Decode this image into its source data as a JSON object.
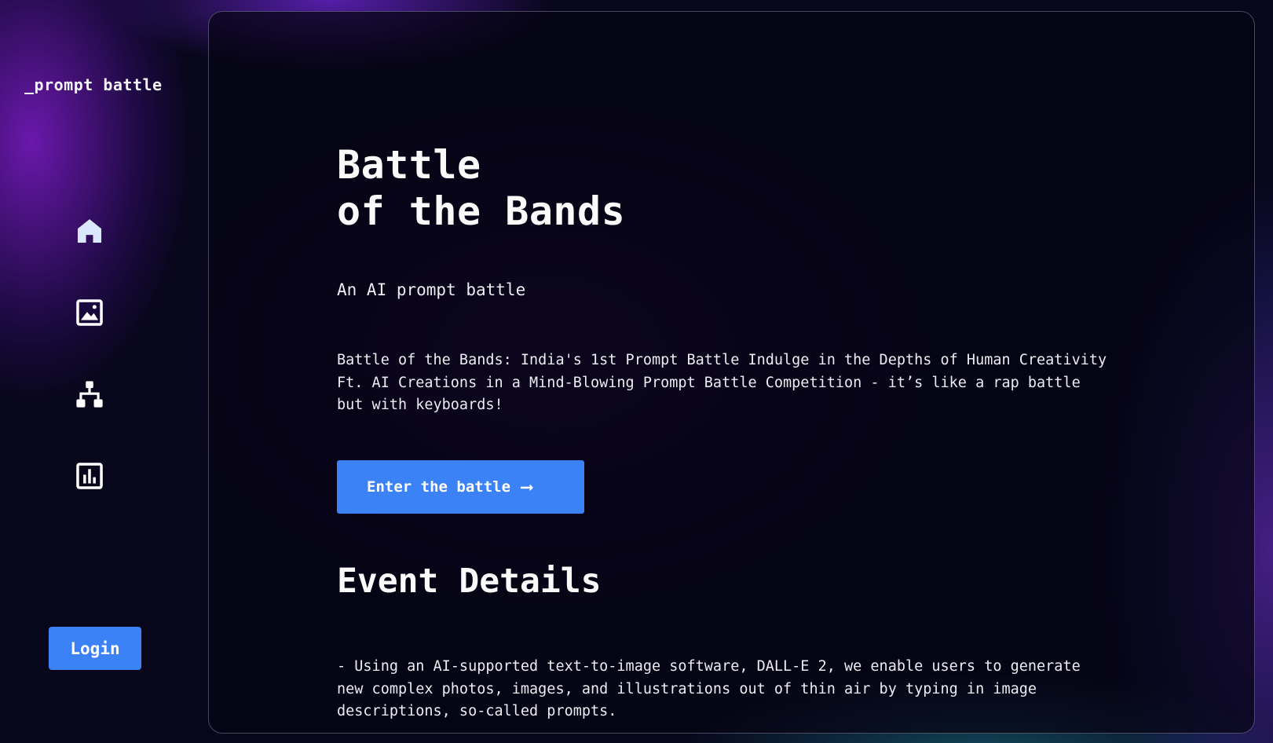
{
  "sidebar": {
    "brand": "_prompt battle",
    "nav": [
      {
        "icon": "home-icon",
        "active": true
      },
      {
        "icon": "image-icon"
      },
      {
        "icon": "sitemap-icon"
      },
      {
        "icon": "bar-chart-icon"
      }
    ],
    "login_label": "Login"
  },
  "main": {
    "title_line1": "Battle",
    "title_line2": "of the Bands",
    "subtitle": "An AI prompt battle",
    "description": "Battle of the Bands: India's 1st Prompt Battle Indulge in the Depths of Human Creativity Ft. AI Creations in a Mind-Blowing Prompt Battle Competition - it’s like a rap battle but with keyboards!",
    "cta_label": "Enter the battle",
    "cta_arrow": "⟶",
    "section_title": "Event Details",
    "details_text": "- Using an AI-supported text-to-image software, DALL-E 2, we enable users to generate new complex photos, images, and illustrations out of thin air by typing in image descriptions, so-called prompts."
  },
  "colors": {
    "accent": "#3b82f6",
    "background": "#07061a",
    "icon_active": "#dbe6ff",
    "icon": "#ffffff"
  }
}
